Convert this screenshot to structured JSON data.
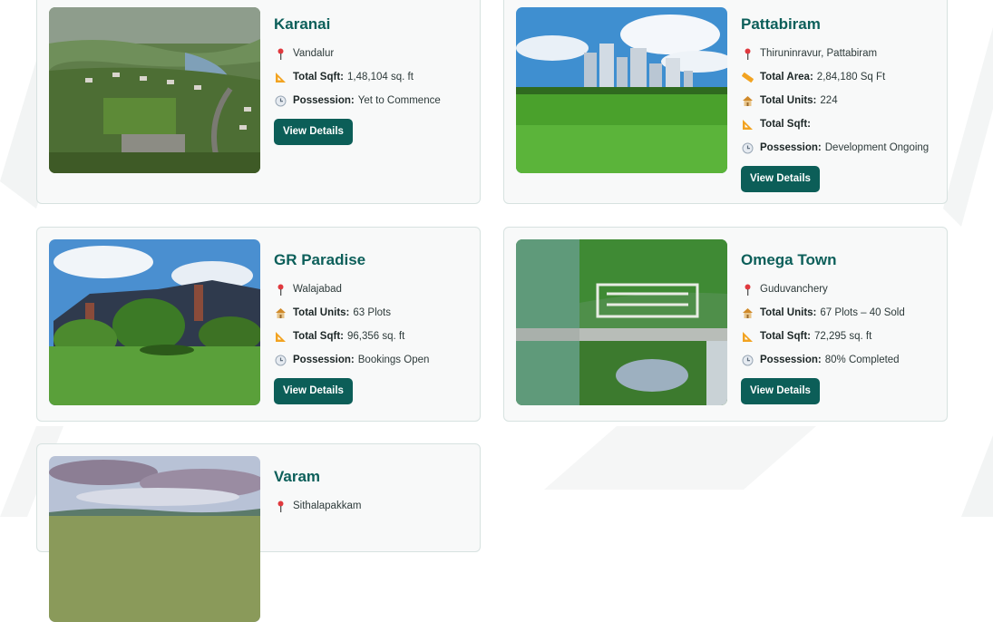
{
  "theme": {
    "accent": "#0c5e58",
    "title_color": "#0c5f5a",
    "card_bg": "#f8f9f9",
    "card_border": "#d7e2e0"
  },
  "projects": [
    {
      "name": "Karanai",
      "location": "Vandalur",
      "area_label": "Total Sqft:",
      "area_value": "1,48,104 sq. ft",
      "possession_label": "Possession:",
      "possession_value": "Yet to Commence",
      "button": "View Details",
      "image": "aerial-suburb-photo"
    },
    {
      "name": "Pattabiram",
      "location": "Thiruninravur, Pattabiram",
      "total_area_label": "Total Area:",
      "total_area_value": "2,84,180 Sq Ft",
      "units_label": "Total Units:",
      "units_value": "224",
      "area_label": "Total Sqft:",
      "area_value": "",
      "possession_label": "Possession:",
      "possession_value": "Development Ongoing",
      "button": "View Details",
      "image": "city-skyline-grass-photo"
    },
    {
      "name": "GR Paradise",
      "location": "Walajabad",
      "units_label": "Total Units:",
      "units_value": "63 Plots",
      "area_label": "Total Sqft:",
      "area_value": "96,356 sq. ft",
      "possession_label": "Possession:",
      "possession_value": "Bookings Open",
      "button": "View Details",
      "image": "house-garden-photo"
    },
    {
      "name": "Omega Town",
      "location": "Guduvanchery",
      "units_label": "Total Units:",
      "units_value": "67 Plots – 40 Sold",
      "area_label": "Total Sqft:",
      "area_value": "72,295 sq. ft",
      "possession_label": "Possession:",
      "possession_value": "80% Completed",
      "button": "View Details",
      "image": "aerial-layout-photo"
    },
    {
      "name": "Varam",
      "location": "Sithalapakkam",
      "image": "countryside-sky-photo"
    }
  ],
  "icons": {
    "location": "map-pin-icon",
    "area": "ruler-triangle-icon",
    "units": "house-icon",
    "possession": "clock-icon",
    "total_area": "ruler-icon"
  }
}
